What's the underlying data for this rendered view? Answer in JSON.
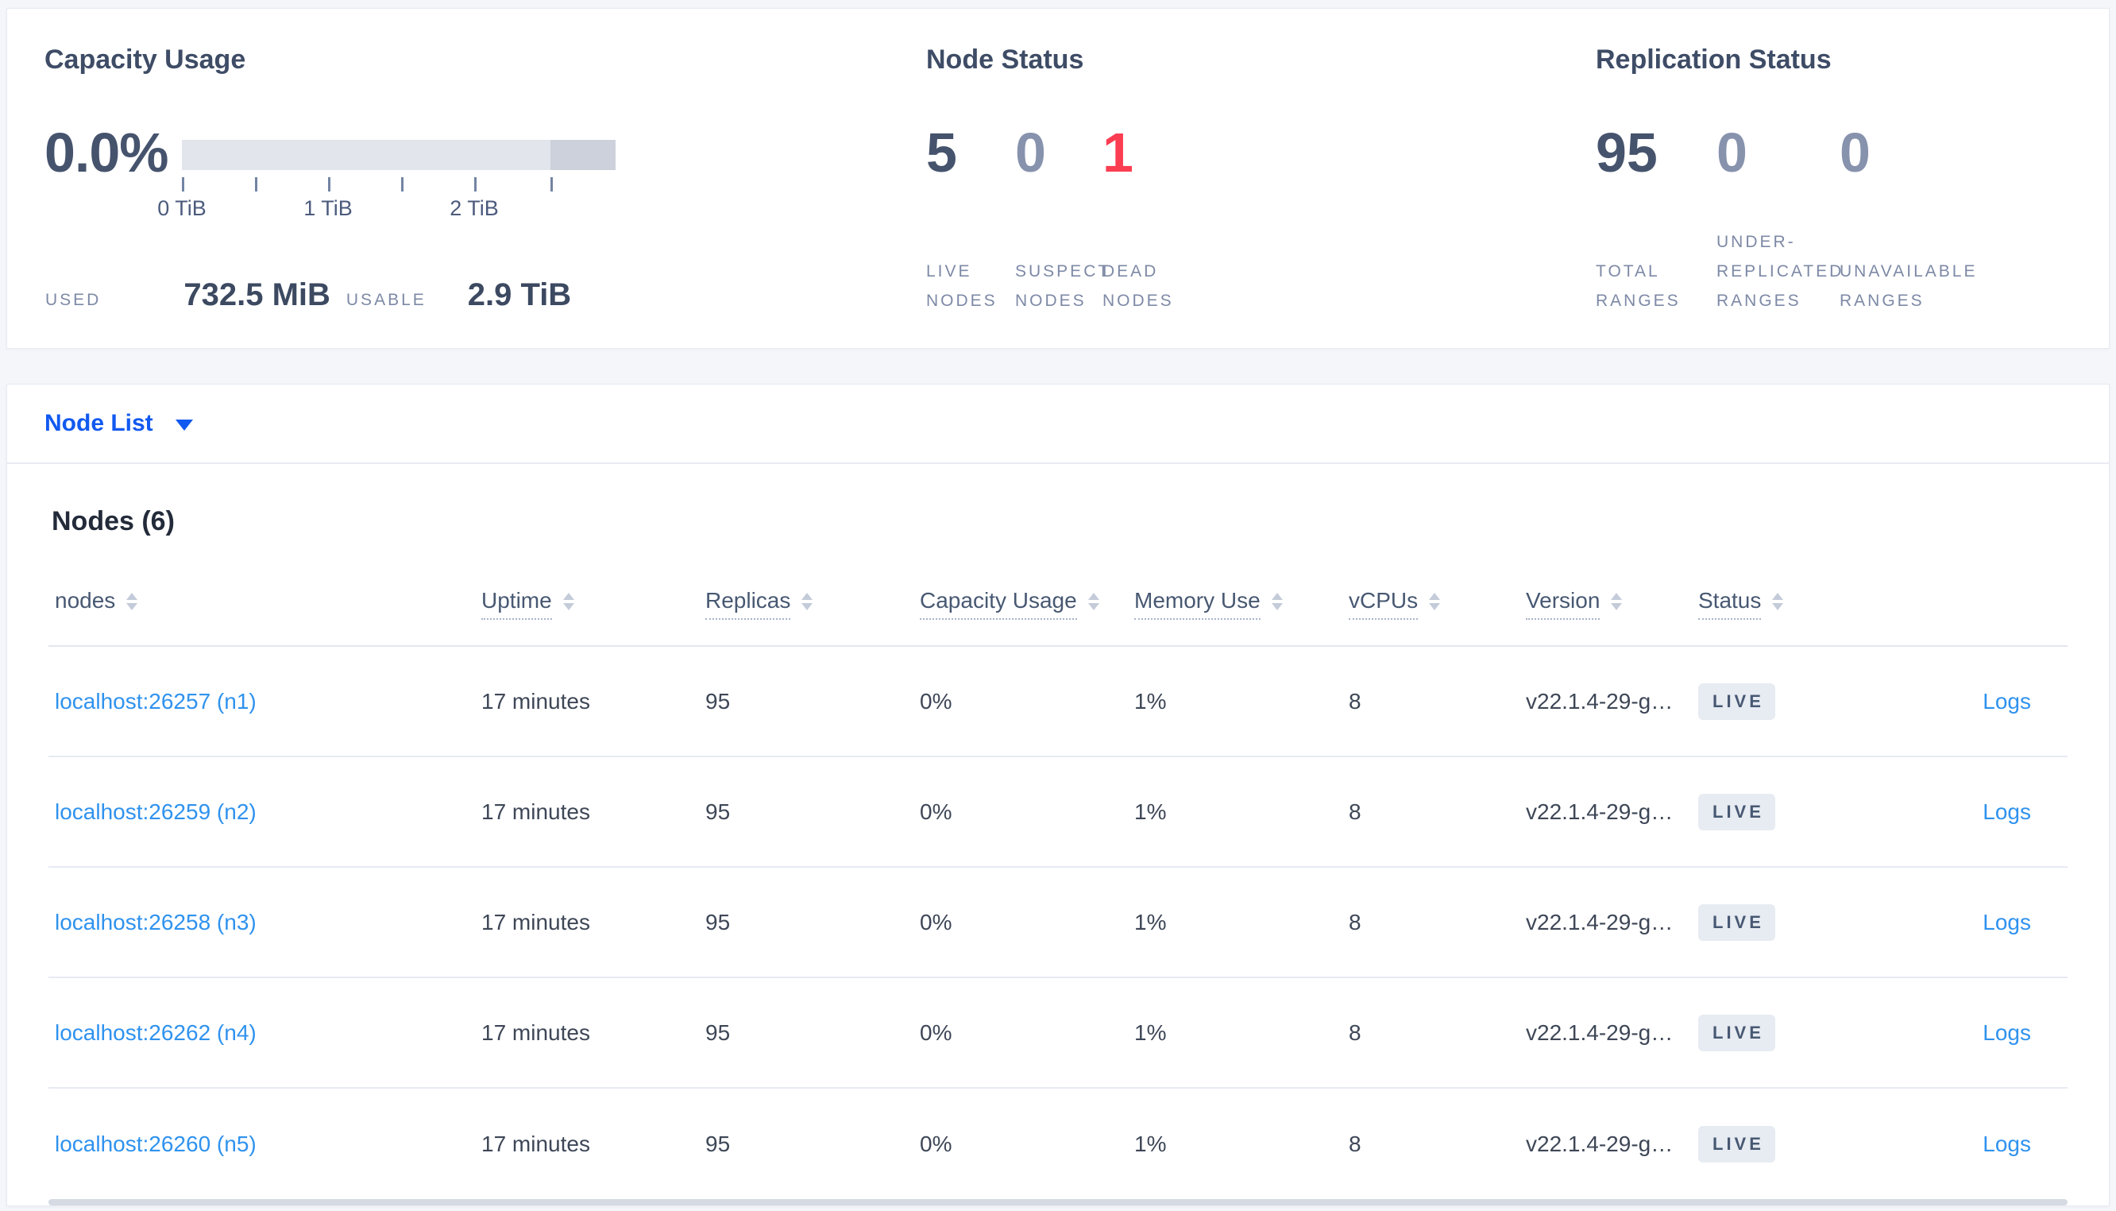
{
  "summary": {
    "capacity": {
      "title": "Capacity Usage",
      "percent": "0.0%",
      "axis_ticks": [
        "0 TiB",
        "1 TiB",
        "2 TiB"
      ],
      "used_label": "USED",
      "used_value": "732.5 MiB",
      "usable_label": "USABLE",
      "usable_value": "2.9 TiB",
      "bar_light_color": "#e2e5ec",
      "bar_dark_color": "#cdd1dc"
    },
    "node_status": {
      "title": "Node Status",
      "stats": [
        {
          "value": "5",
          "label": "LIVE\nNODES",
          "color": "dark"
        },
        {
          "value": "0",
          "label": "SUSPECT\nNODES",
          "color": "muted"
        },
        {
          "value": "1",
          "label": "DEAD\nNODES",
          "color": "red"
        }
      ]
    },
    "replication": {
      "title": "Replication Status",
      "stats": [
        {
          "value": "95",
          "label": "TOTAL\nRANGES",
          "color": "dark"
        },
        {
          "value": "0",
          "label": "UNDER-\nREPLICATED\nRANGES",
          "color": "muted"
        },
        {
          "value": "0",
          "label": "UNAVAILABLE\nRANGES",
          "color": "muted"
        }
      ]
    }
  },
  "node_list": {
    "selector_label": "Node List"
  },
  "nodes_table": {
    "title": "Nodes (6)",
    "columns": [
      {
        "label": "nodes"
      },
      {
        "label": "Uptime"
      },
      {
        "label": "Replicas"
      },
      {
        "label": "Capacity Usage"
      },
      {
        "label": "Memory Use"
      },
      {
        "label": "vCPUs"
      },
      {
        "label": "Version"
      },
      {
        "label": "Status"
      },
      {
        "label": ""
      }
    ],
    "rows": [
      {
        "address": "localhost:26257 (n1)",
        "uptime": "17 minutes",
        "replicas": "95",
        "capacity": "0%",
        "memory": "1%",
        "vcpus": "8",
        "version": "v22.1.4-29-g…",
        "status": "LIVE",
        "logs": "Logs"
      },
      {
        "address": "localhost:26259 (n2)",
        "uptime": "17 minutes",
        "replicas": "95",
        "capacity": "0%",
        "memory": "1%",
        "vcpus": "8",
        "version": "v22.1.4-29-g…",
        "status": "LIVE",
        "logs": "Logs"
      },
      {
        "address": "localhost:26258 (n3)",
        "uptime": "17 minutes",
        "replicas": "95",
        "capacity": "0%",
        "memory": "1%",
        "vcpus": "8",
        "version": "v22.1.4-29-g…",
        "status": "LIVE",
        "logs": "Logs"
      },
      {
        "address": "localhost:26262 (n4)",
        "uptime": "17 minutes",
        "replicas": "95",
        "capacity": "0%",
        "memory": "1%",
        "vcpus": "8",
        "version": "v22.1.4-29-g…",
        "status": "LIVE",
        "logs": "Logs"
      },
      {
        "address": "localhost:26260 (n5)",
        "uptime": "17 minutes",
        "replicas": "95",
        "capacity": "0%",
        "memory": "1%",
        "vcpus": "8",
        "version": "v22.1.4-29-g…",
        "status": "LIVE",
        "logs": "Logs"
      }
    ]
  },
  "colors": {
    "accent_blue": "#1259f0",
    "link_blue": "#2f92ee",
    "dead_red": "#fb3d52",
    "slate_dark": "#46536d",
    "slate_muted": "#8792ad"
  }
}
